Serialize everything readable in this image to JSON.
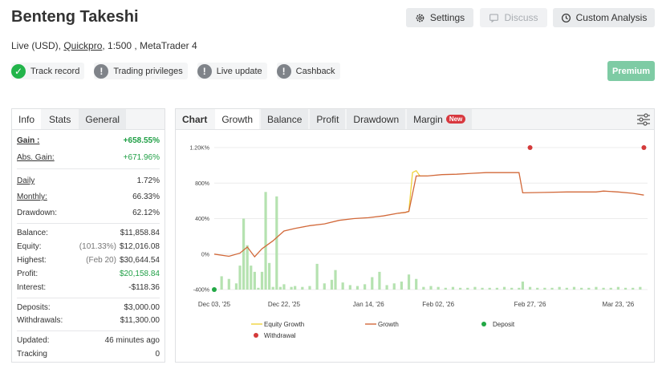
{
  "header": {
    "title": "Benteng Takeshi",
    "subtitle_prefix": "Live (USD), ",
    "broker": "Quickpro",
    "subtitle_suffix": ", 1:500 , MetaTrader 4"
  },
  "buttons": {
    "settings": "Settings",
    "discuss": "Discuss",
    "custom_analysis": "Custom Analysis",
    "premium": "Premium"
  },
  "badges": {
    "track_record": "Track record",
    "trading_privileges": "Trading privileges",
    "live_update": "Live update",
    "cashback": "Cashback"
  },
  "stats_tabs": [
    "Info",
    "Stats",
    "General"
  ],
  "stats": {
    "gain": {
      "label": "Gain :",
      "value": "+658.55%"
    },
    "abs_gain": {
      "label": "Abs. Gain:",
      "value": "+671.96%"
    },
    "daily": {
      "label": "Daily",
      "value": "1.72%"
    },
    "monthly": {
      "label": "Monthly:",
      "value": "66.33%"
    },
    "drawdown": {
      "label": "Drawdown:",
      "value": "62.12%"
    },
    "balance": {
      "label": "Balance:",
      "value": "$11,858.84"
    },
    "equity": {
      "label": "Equity:",
      "note": "(101.33%)",
      "value": "$12,016.08"
    },
    "highest": {
      "label": "Highest:",
      "note": "(Feb 20)",
      "value": "$30,644.54"
    },
    "profit": {
      "label": "Profit:",
      "value": "$20,158.84"
    },
    "interest": {
      "label": "Interest:",
      "value": "-$118.36"
    },
    "deposits": {
      "label": "Deposits:",
      "value": "$3,000.00"
    },
    "withdrawals": {
      "label": "Withdrawals:",
      "value": "$11,300.00"
    },
    "updated": {
      "label": "Updated:",
      "value": "46 minutes ago"
    },
    "tracking": {
      "label": "Tracking",
      "value": "0"
    }
  },
  "chart_tabs": [
    "Chart",
    "Growth",
    "Balance",
    "Profit",
    "Drawdown",
    "Margin"
  ],
  "new_badge": "New",
  "colors": {
    "growth_line": "#d2693a",
    "equity_line": "#f0d23a",
    "bars": "#b5e2b0",
    "deposit": "#22a845",
    "withdrawal": "#d43a3a",
    "premium": "#7ecba4"
  },
  "chart_data": {
    "type": "line",
    "y_ticks": [
      "1.20K%",
      "800%",
      "400%",
      "0%",
      "-400%"
    ],
    "ylim": [
      -400,
      1200
    ],
    "x_ticks": [
      "Dec 03, '25",
      "Dec 22, '25",
      "Jan 14, '26",
      "Feb 02, '26",
      "Feb 27, '26",
      "Mar 23, '26"
    ],
    "x_tick_days": [
      0,
      19,
      42,
      61,
      86,
      110
    ],
    "x_range_days": [
      0,
      118
    ],
    "series": [
      {
        "name": "Growth",
        "points": [
          [
            0,
            0
          ],
          [
            4,
            -25
          ],
          [
            7,
            10
          ],
          [
            9,
            80
          ],
          [
            11,
            -30
          ],
          [
            13,
            60
          ],
          [
            16,
            150
          ],
          [
            19,
            260
          ],
          [
            22,
            290
          ],
          [
            26,
            320
          ],
          [
            30,
            340
          ],
          [
            34,
            380
          ],
          [
            38,
            400
          ],
          [
            42,
            410
          ],
          [
            46,
            430
          ],
          [
            50,
            460
          ],
          [
            52,
            470
          ],
          [
            53,
            480
          ],
          [
            55,
            880
          ],
          [
            58,
            880
          ],
          [
            62,
            895
          ],
          [
            66,
            900
          ],
          [
            70,
            910
          ],
          [
            74,
            918
          ],
          [
            80,
            918
          ],
          [
            83,
            918
          ],
          [
            84,
            690
          ],
          [
            90,
            695
          ],
          [
            96,
            700
          ],
          [
            104,
            700
          ],
          [
            106,
            710
          ],
          [
            110,
            700
          ],
          [
            114,
            685
          ],
          [
            117,
            665
          ]
        ]
      },
      {
        "name": "Equity Growth",
        "points": [
          [
            50,
            460
          ],
          [
            52,
            470
          ],
          [
            53,
            480
          ],
          [
            54,
            920
          ],
          [
            55,
            940
          ],
          [
            56,
            880
          ],
          [
            58,
            880
          ]
        ]
      }
    ],
    "bars": [
      [
        2,
        -400,
        -250
      ],
      [
        4,
        -400,
        -280
      ],
      [
        6,
        -400,
        -330
      ],
      [
        7,
        -400,
        -130
      ],
      [
        8,
        -400,
        400
      ],
      [
        9,
        -400,
        100
      ],
      [
        10,
        -400,
        -130
      ],
      [
        11,
        -400,
        -200
      ],
      [
        12,
        -400,
        -380
      ],
      [
        13,
        -400,
        -200
      ],
      [
        14,
        -400,
        700
      ],
      [
        15,
        -400,
        -100
      ],
      [
        16,
        -400,
        -370
      ],
      [
        17,
        -400,
        650
      ],
      [
        18,
        -400,
        -370
      ],
      [
        19,
        -400,
        -340
      ],
      [
        21,
        -400,
        -370
      ],
      [
        22,
        -400,
        -360
      ],
      [
        24,
        -400,
        -370
      ],
      [
        26,
        -400,
        -360
      ],
      [
        28,
        -400,
        -110
      ],
      [
        30,
        -400,
        -330
      ],
      [
        32,
        -400,
        -290
      ],
      [
        33,
        -400,
        -180
      ],
      [
        35,
        -400,
        -320
      ],
      [
        37,
        -400,
        -350
      ],
      [
        39,
        -400,
        -360
      ],
      [
        41,
        -400,
        -340
      ],
      [
        43,
        -400,
        -260
      ],
      [
        45,
        -400,
        -200
      ],
      [
        47,
        -400,
        -350
      ],
      [
        49,
        -400,
        -330
      ],
      [
        51,
        -400,
        -310
      ],
      [
        53,
        -400,
        -230
      ],
      [
        55,
        -400,
        -280
      ],
      [
        57,
        -400,
        -370
      ],
      [
        59,
        -400,
        -360
      ],
      [
        61,
        -400,
        -370
      ],
      [
        63,
        -400,
        -380
      ],
      [
        65,
        -400,
        -370
      ],
      [
        67,
        -400,
        -380
      ],
      [
        69,
        -400,
        -380
      ],
      [
        71,
        -400,
        -370
      ],
      [
        73,
        -400,
        -380
      ],
      [
        75,
        -400,
        -380
      ],
      [
        77,
        -400,
        -380
      ],
      [
        79,
        -400,
        -370
      ],
      [
        81,
        -400,
        -380
      ],
      [
        83,
        -400,
        -380
      ],
      [
        84,
        -400,
        -310
      ],
      [
        86,
        -400,
        -370
      ],
      [
        88,
        -400,
        -380
      ],
      [
        90,
        -400,
        -380
      ],
      [
        92,
        -400,
        -380
      ],
      [
        94,
        -400,
        -370
      ],
      [
        96,
        -400,
        -380
      ],
      [
        98,
        -400,
        -370
      ],
      [
        100,
        -400,
        -380
      ],
      [
        102,
        -400,
        -380
      ],
      [
        104,
        -400,
        -370
      ],
      [
        106,
        -400,
        -380
      ],
      [
        108,
        -400,
        -380
      ],
      [
        110,
        -400,
        -370
      ],
      [
        112,
        -400,
        -380
      ],
      [
        114,
        -400,
        -380
      ],
      [
        116,
        -400,
        -370
      ]
    ],
    "markers": {
      "deposits": [
        [
          0,
          -400
        ]
      ],
      "withdrawals": [
        [
          86,
          1200
        ],
        [
          117,
          1200
        ]
      ]
    },
    "legend": [
      "Equity Growth",
      "Growth",
      "Deposit",
      "Withdrawal"
    ]
  }
}
